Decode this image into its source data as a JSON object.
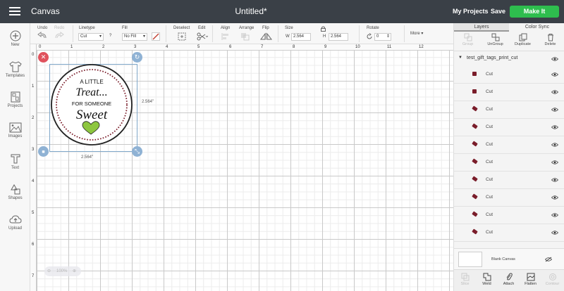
{
  "topbar": {
    "app_title": "Canvas",
    "doc_title": "Untitled*",
    "my_projects": "My Projects",
    "save": "Save",
    "make_it": "Make It"
  },
  "leftnav": {
    "items": [
      {
        "label": "New",
        "icon": "plus-icon"
      },
      {
        "label": "Templates",
        "icon": "shirt-icon"
      },
      {
        "label": "Projects",
        "icon": "projects-icon"
      },
      {
        "label": "Images",
        "icon": "image-icon"
      },
      {
        "label": "Text",
        "icon": "text-icon"
      },
      {
        "label": "Shapes",
        "icon": "shapes-icon"
      },
      {
        "label": "Upload",
        "icon": "upload-icon"
      }
    ]
  },
  "toolbar": {
    "undo": "Undo",
    "redo": "Redo",
    "linetype_label": "Linetype",
    "linetype_value": "Cut",
    "fill_label": "Fill",
    "fill_value": "No Fill",
    "deselect": "Deselect",
    "edit": "Edit",
    "align": "Align",
    "arrange": "Arrange",
    "flip": "Flip",
    "size_label": "Size",
    "w_label": "W",
    "w_value": "2.564",
    "h_label": "H",
    "h_value": "2.564",
    "rotate_label": "Rotate",
    "rotate_value": "0",
    "more": "More",
    "help": "?"
  },
  "canvas": {
    "ruler_top": [
      "0",
      "1",
      "2",
      "3",
      "4",
      "5",
      "6",
      "7",
      "8",
      "9",
      "10",
      "11",
      "12"
    ],
    "ruler_left": [
      "0",
      "1",
      "2",
      "3",
      "4",
      "5",
      "6",
      "7"
    ],
    "width_label": "2.564\"",
    "height_label": "2.564\"",
    "zoom_value": "100%",
    "design": {
      "line1": "A LITTLE",
      "line2": "Treat...",
      "line3": "FOR SOMEONE",
      "line4": "Sweet",
      "heart_color": "#8dc63f",
      "dot_color": "#7a1d2a"
    }
  },
  "rightpanel": {
    "tabs": [
      "Layers",
      "Color Sync"
    ],
    "actions": [
      "Group",
      "UnGroup",
      "Duplicate",
      "Delete"
    ],
    "group_name": "test_gift_tags_print_cut",
    "layers": [
      "Cut",
      "Cut",
      "Cut",
      "Cut",
      "Cut",
      "Cut",
      "Cut",
      "Cut",
      "Cut",
      "Cut"
    ],
    "blank_canvas": "Blank Canvas",
    "bottom_actions": [
      "Slice",
      "Weld",
      "Attach",
      "Flatten",
      "Contour"
    ]
  },
  "colors": {
    "topbar_bg": "#3a4047",
    "make_it_green": "#2ebd4e",
    "handle_red": "#e0525d",
    "handle_blue": "#8fb2d4"
  }
}
